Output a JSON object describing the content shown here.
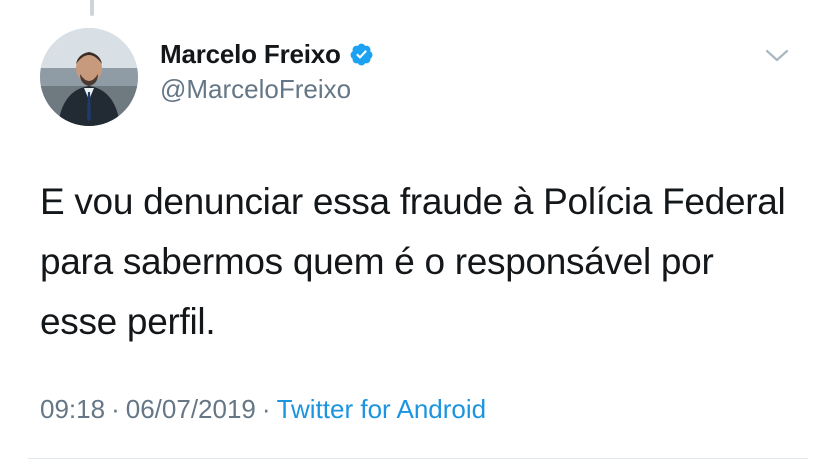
{
  "tweet": {
    "author": {
      "name": "Marcelo Freixo",
      "handle": "@MarceloFreixo",
      "verified_icon": "verified-badge-icon"
    },
    "text": "E vou denunciar essa fraude à Polícia Federal para sabermos quem é o responsável por esse perfil.",
    "time": "09:18",
    "date": "06/07/2019",
    "separator": "·",
    "source": "Twitter for Android",
    "menu_icon": "chevron-down-icon"
  },
  "colors": {
    "text": "#14171a",
    "secondary": "#657786",
    "link": "#1b95e0",
    "verified": "#1da1f2",
    "divider": "#e1e8ed"
  }
}
